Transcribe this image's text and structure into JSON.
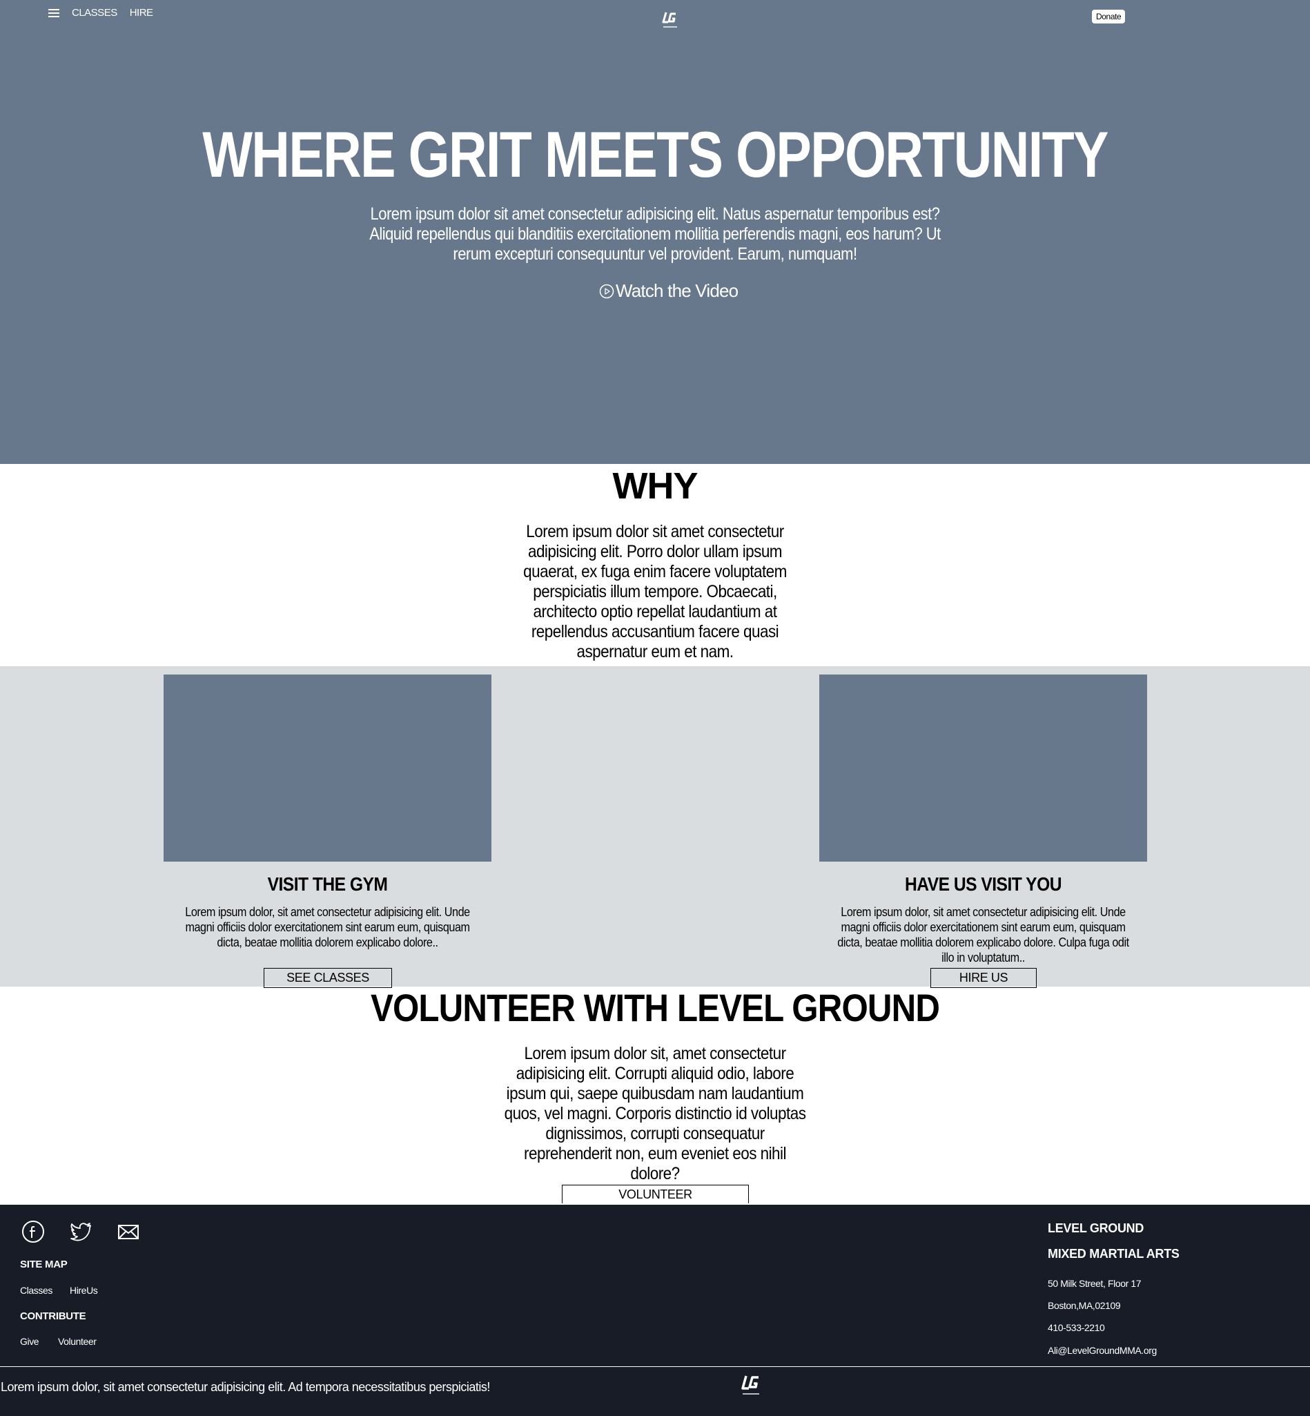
{
  "nav": {
    "links": [
      "CLASSES",
      "HIRE"
    ],
    "donate_label": "Donate"
  },
  "hero": {
    "title": "WHERE GRIT MEETS OPPORTUNITY",
    "text": "Lorem ipsum dolor sit amet consectetur adipisicing elit. Natus aspernatur temporibus est? Aliquid repellendus qui blanditiis exercitationem mollitia perferendis magni, eos harum? Ut rerum excepturi consequuntur vel provident. Earum, numquam!",
    "video_label": "Watch the Video"
  },
  "why": {
    "title": "WHY",
    "text": "Lorem ipsum dolor sit amet consectetur adipisicing elit. Porro dolor ullam ipsum quaerat, ex fuga enim facere voluptatem perspiciatis illum tempore. Obcaecati, architecto optio repellat laudantium at repellendus accusantium facere quasi aspernatur eum et nam."
  },
  "cards": [
    {
      "title": "VISIT THE GYM",
      "text": "Lorem ipsum dolor, sit amet consectetur adipisicing elit. Unde magni officiis dolor exercitationem sint earum eum, quisquam dicta, beatae mollitia dolorem explicabo dolore..",
      "button": "SEE CLASSES"
    },
    {
      "title": "HAVE US VISIT YOU",
      "text": "Lorem ipsum dolor, sit amet consectetur adipisicing elit. Unde magni officiis dolor exercitationem sint earum eum, quisquam dicta, beatae mollitia dolorem explicabo dolore. Culpa fuga odit illo in voluptatum..",
      "button": "HIRE US"
    }
  ],
  "volunteer": {
    "title": "VOLUNTEER WITH LEVEL GROUND",
    "text": "Lorem ipsum dolor sit, amet consectetur adipisicing elit. Corrupti aliquid odio, labore ipsum qui, saepe quibusdam nam laudantium quos, vel magni. Corporis distinctio id voluptas dignissimos, corrupti consequatur reprehenderit non, eum eveniet eos nihil dolore?",
    "button": "VOLUNTEER"
  },
  "footer": {
    "social_icons": [
      "facebook-icon",
      "twitter-icon",
      "mail-icon"
    ],
    "site_map_heading": "SITE MAP",
    "site_map_links": [
      "Classes",
      "HireUs"
    ],
    "contribute_heading": "CONTRIBUTE",
    "contribute_links": [
      "Give",
      "Volunteer"
    ],
    "org_line1": "LEVEL GROUND",
    "org_line2": "MIXED MARTIAL ARTS",
    "address": "50 Milk Street, Floor 17",
    "city": "Boston,MA,02109",
    "phone": "410-533-2210",
    "email": "Ali@LevelGroundMMA.org",
    "bottom_text": "Lorem ipsum dolor, sit amet consectetur adipisicing elit. Ad tempora necessitatibus perspiciatis!"
  },
  "colors": {
    "hero_bg": "#67778c",
    "band_bg": "#dadde0",
    "footer_bg": "#171c26"
  }
}
